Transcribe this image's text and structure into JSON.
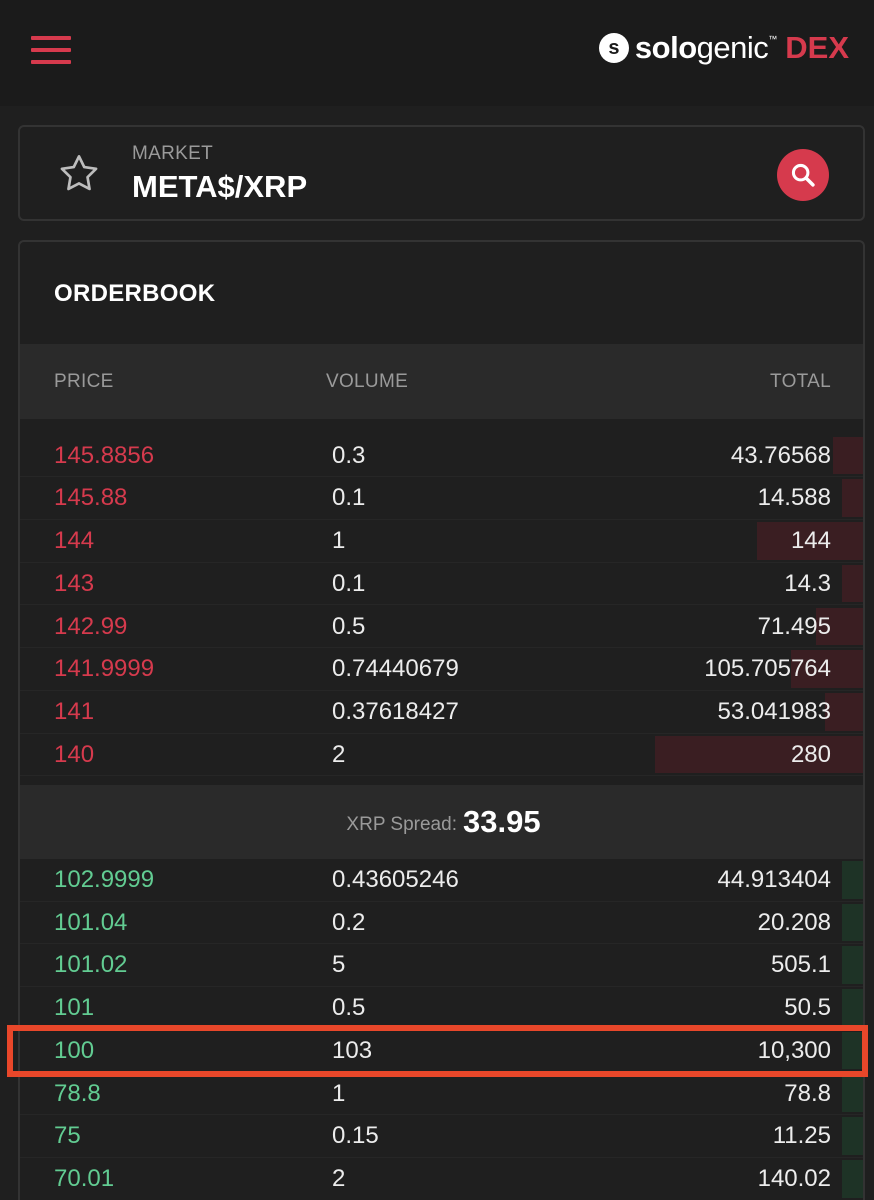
{
  "header": {
    "menu_icon": "hamburger-menu-icon",
    "brand": {
      "name_bold": "solo",
      "name_rest": "genic",
      "tm": "™",
      "suffix": "DEX",
      "mark": "s"
    }
  },
  "market": {
    "label": "MARKET",
    "pair": "META$/XRP",
    "favorite_icon": "star-outline-icon",
    "search_icon": "search-icon"
  },
  "orderbook": {
    "title": "ORDERBOOK",
    "columns": {
      "price": "PRICE",
      "volume": "VOLUME",
      "total": "TOTAL"
    },
    "asks": [
      {
        "price": "145.8856",
        "volume": "0.3",
        "total": "43.76568",
        "depth": 0.04
      },
      {
        "price": "145.88",
        "volume": "0.1",
        "total": "14.588",
        "depth": 0.03
      },
      {
        "price": "144",
        "volume": "1",
        "total": "144",
        "depth": 0.13
      },
      {
        "price": "143",
        "volume": "0.1",
        "total": "14.3",
        "depth": 0.03
      },
      {
        "price": "142.99",
        "volume": "0.5",
        "total": "71.495",
        "depth": 0.06
      },
      {
        "price": "141.9999",
        "volume": "0.74440679",
        "total": "105.705764",
        "depth": 0.09
      },
      {
        "price": "141",
        "volume": "0.37618427",
        "total": "53.041983",
        "depth": 0.05
      },
      {
        "price": "140",
        "volume": "2",
        "total": "280",
        "depth": 0.25
      }
    ],
    "spread": {
      "label": "XRP Spread:",
      "value": "33.95"
    },
    "bids": [
      {
        "price": "102.9999",
        "volume": "0.43605246",
        "total": "44.913404",
        "depth": 0.03
      },
      {
        "price": "101.04",
        "volume": "0.2",
        "total": "20.208",
        "depth": 0.03
      },
      {
        "price": "101.02",
        "volume": "5",
        "total": "505.1",
        "depth": 0.03
      },
      {
        "price": "101",
        "volume": "0.5",
        "total": "50.5",
        "depth": 0.03
      },
      {
        "price": "100",
        "volume": "103",
        "total": "10,300",
        "depth": 0.03
      },
      {
        "price": "78.8",
        "volume": "1",
        "total": "78.8",
        "depth": 0.03
      },
      {
        "price": "75",
        "volume": "0.15",
        "total": "11.25",
        "depth": 0.03
      },
      {
        "price": "70.01",
        "volume": "2",
        "total": "140.02",
        "depth": 0.03
      }
    ],
    "highlighted_bid_index": 4
  },
  "colors": {
    "accent": "#d63a4d",
    "bid": "#62cc92",
    "highlight": "#e8472a"
  }
}
